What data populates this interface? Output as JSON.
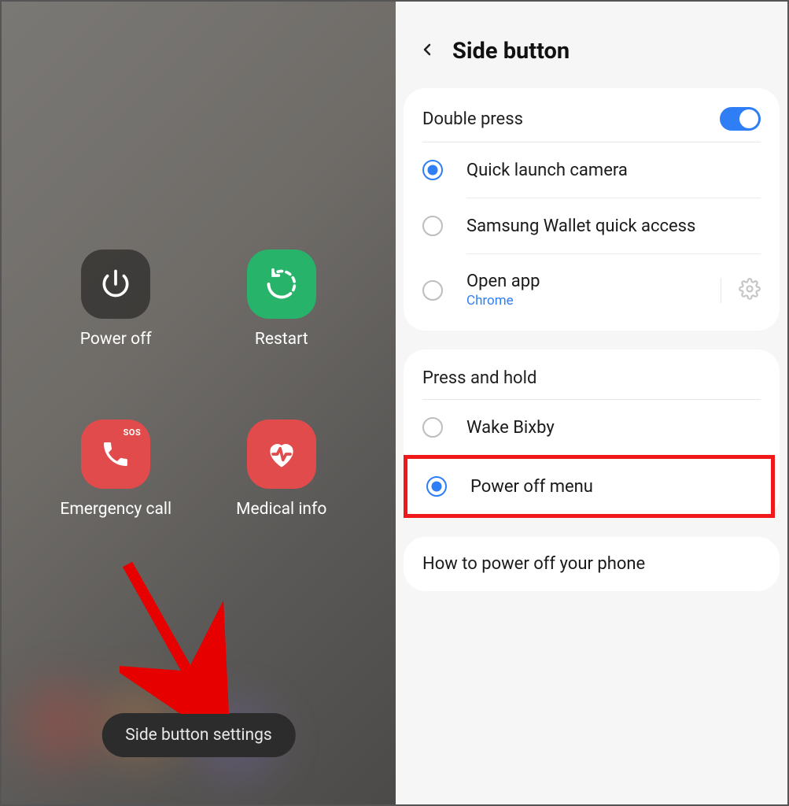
{
  "left": {
    "power_off": "Power off",
    "restart": "Restart",
    "emergency_call": "Emergency call",
    "sos_badge": "SOS",
    "medical_info": "Medical info",
    "side_button_settings": "Side button settings"
  },
  "right": {
    "title": "Side button",
    "double_press": {
      "label": "Double press",
      "toggle_on": true,
      "options": {
        "camera": "Quick launch camera",
        "wallet": "Samsung Wallet quick access",
        "open_app": "Open app",
        "open_app_sub": "Chrome"
      }
    },
    "press_hold": {
      "label": "Press and hold",
      "options": {
        "bixby": "Wake Bixby",
        "power_menu": "Power off menu"
      }
    },
    "how_to": "How to power off your phone"
  }
}
